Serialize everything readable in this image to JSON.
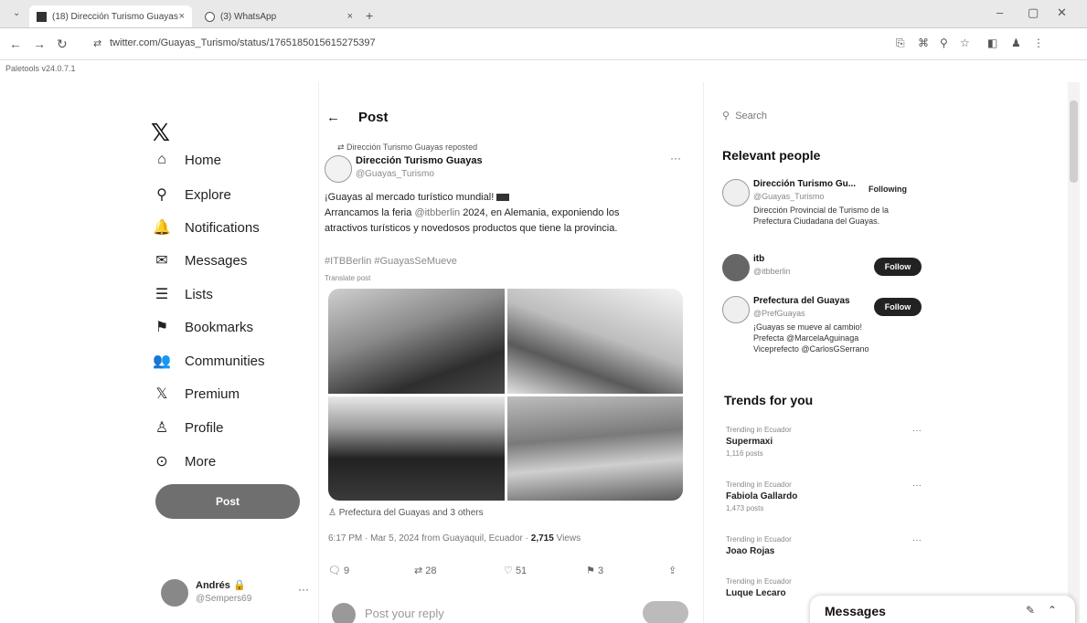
{
  "browser": {
    "tabs": [
      {
        "title": "(18) Dirección Turismo Guayas",
        "close": "×"
      },
      {
        "title": "(3) WhatsApp",
        "close": "×"
      }
    ],
    "new_tab": "+",
    "url_site_icon": "⇄",
    "url": "twitter.com/Guayas_Turismo/status/1765185015615275397",
    "bookmark": "Paletools v24.0.7.1",
    "window_controls": {
      "minimize": "–",
      "maximize": "▢",
      "close": "✕"
    }
  },
  "sidebar": {
    "logo": "𝕏",
    "items": [
      {
        "label": "Home",
        "icon": "⌂"
      },
      {
        "label": "Explore",
        "icon": "⚲"
      },
      {
        "label": "Notifications",
        "icon": "🔔"
      },
      {
        "label": "Messages",
        "icon": "✉"
      },
      {
        "label": "Lists",
        "icon": "☰"
      },
      {
        "label": "Bookmarks",
        "icon": "⚑"
      },
      {
        "label": "Communities",
        "icon": "👥"
      },
      {
        "label": "Premium",
        "icon": "𝕏"
      },
      {
        "label": "Profile",
        "icon": "♙"
      },
      {
        "label": "More",
        "icon": "⊙"
      }
    ],
    "post_button": "Post",
    "account": {
      "name": "Andrés 🔒",
      "handle": "@Sempers69",
      "more": "···"
    }
  },
  "post": {
    "header": "Post",
    "back": "←",
    "repost_line": "⇄ Dirección Turismo Guayas reposted",
    "author_name": "Dirección Turismo Guayas",
    "author_handle": "@Guayas_Turismo",
    "more": "···",
    "text_line1": "¡Guayas al mercado turístico mundial!",
    "text_line2_a": "Arrancamos la feria ",
    "text_line2_mention": "@itbberlin",
    "text_line2_b": " 2024, en Alemania, exponiendo los",
    "text_line3": "atractivos turísticos y novedosos productos que tiene la provincia.",
    "hashtags": "#ITBBerlin #GuayasSeMueve",
    "translate": "Translate post",
    "tagged": "♙ Prefectura del Guayas and 3 others",
    "meta_prefix": "6:17 PM · Mar 5, 2024 from Guayaquil, Ecuador · ",
    "views": "2,715",
    "views_label": " Views",
    "actions": {
      "replies": "9",
      "reposts": "28",
      "likes": "51",
      "bookmarks": "3"
    },
    "reply_placeholder": "Post your reply"
  },
  "right": {
    "search_placeholder": "Search",
    "relevant_title": "Relevant people",
    "people": [
      {
        "name": "Dirección Turismo Gu...",
        "handle": "@Guayas_Turismo",
        "bio": "Dirección Provincial de Turismo de la Prefectura Ciudadana del Guayas.",
        "button": "Following"
      },
      {
        "name": "itb",
        "handle": "@itbberlin",
        "bio": "",
        "button": "Follow"
      },
      {
        "name": "Prefectura del Guayas",
        "handle": "@PrefGuayas",
        "bio": "¡Guayas se mueve al cambio! Prefecta @MarcelaAguinaga Viceprefecto @CarlosGSerrano",
        "button": "Follow"
      }
    ],
    "trends_title": "Trends for you",
    "trends": [
      {
        "context": "Trending in Ecuador",
        "name": "Supermaxi",
        "posts": "1,116 posts"
      },
      {
        "context": "Trending in Ecuador",
        "name": "Fabiola Gallardo",
        "posts": "1,473 posts"
      },
      {
        "context": "Trending in Ecuador",
        "name": "Joao Rojas",
        "posts": ""
      },
      {
        "context": "Trending in Ecuador",
        "name": "Luque Lecaro",
        "posts": ""
      }
    ],
    "messages_title": "Messages"
  }
}
